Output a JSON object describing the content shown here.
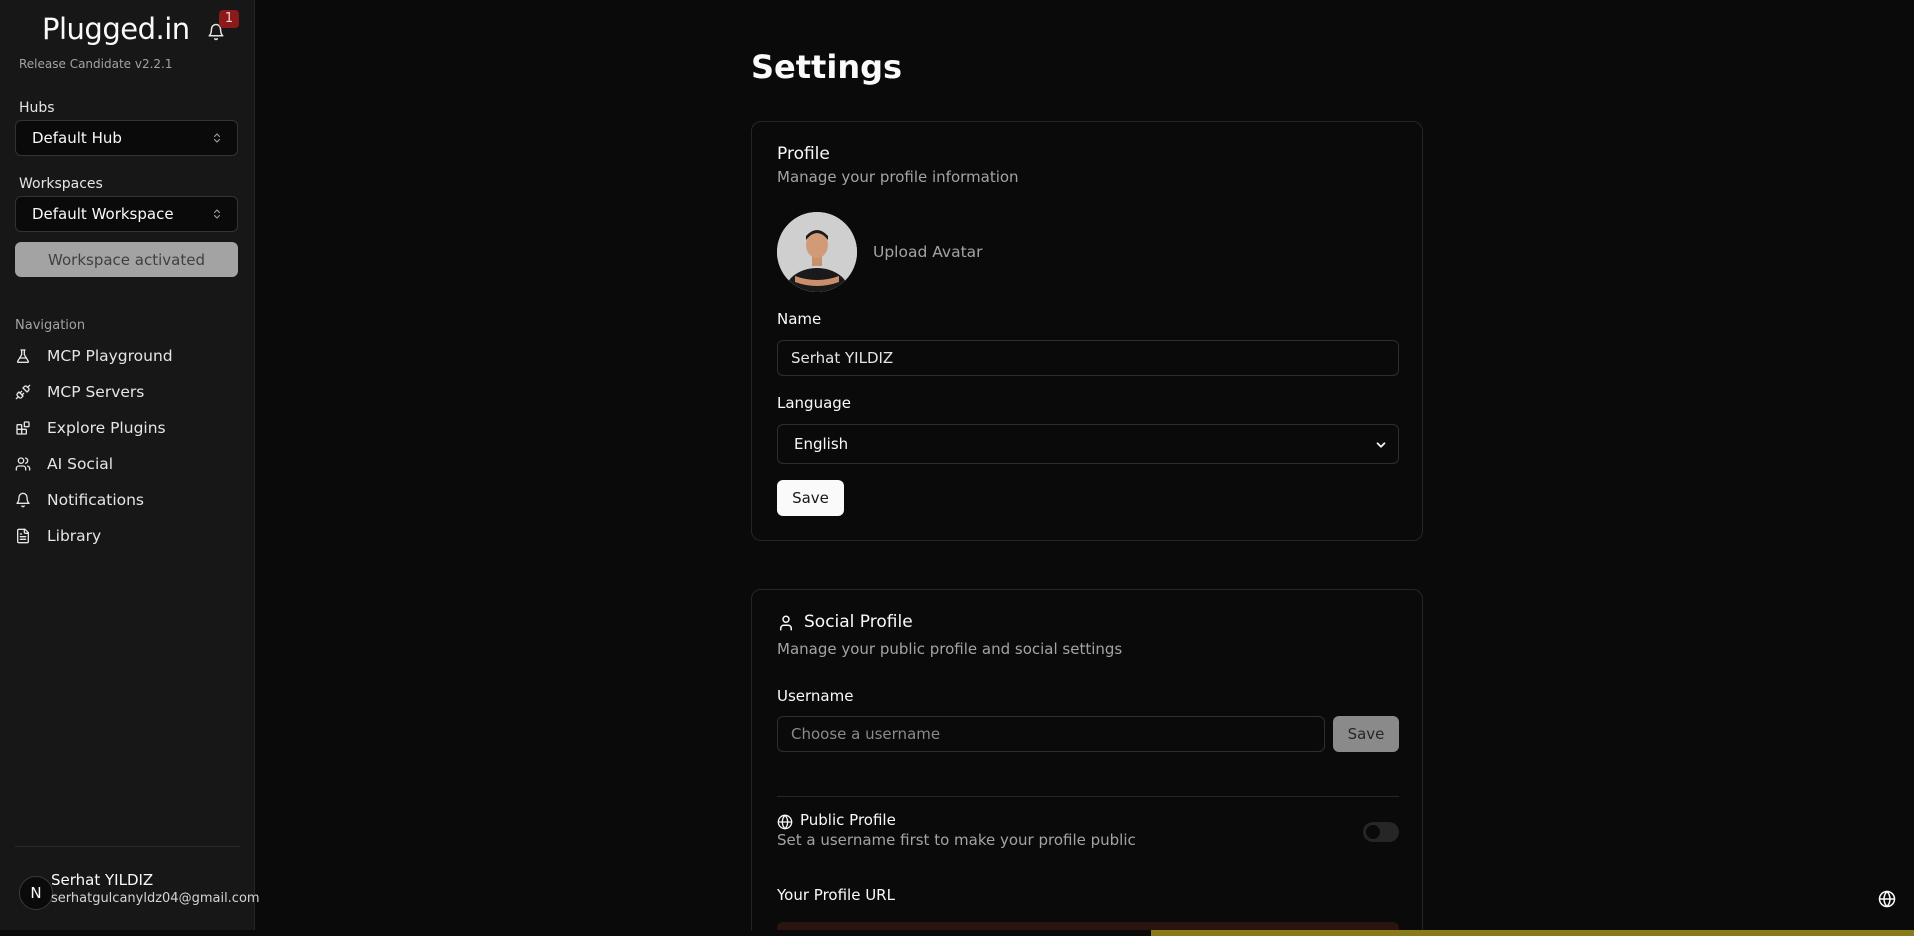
{
  "sidebar": {
    "logo": "Plugged.in",
    "notification_count": "1",
    "version": "Release Candidate v2.2.1",
    "hubs_label": "Hubs",
    "hub_selected": "Default Hub",
    "workspaces_label": "Workspaces",
    "workspace_selected": "Default Workspace",
    "workspace_button": "Workspace activated",
    "nav_title": "Navigation",
    "nav_items": [
      {
        "label": "MCP Playground",
        "icon": "flask-icon"
      },
      {
        "label": "MCP Servers",
        "icon": "plug-icon"
      },
      {
        "label": "Explore Plugins",
        "icon": "blocks-icon"
      },
      {
        "label": "AI Social",
        "icon": "users-icon"
      },
      {
        "label": "Notifications",
        "icon": "bell-icon"
      },
      {
        "label": "Library",
        "icon": "document-icon"
      }
    ],
    "user": {
      "initial": "N",
      "name": "Serhat YILDIZ",
      "email": "serhatgulcanyldz04@gmail.com"
    }
  },
  "main": {
    "title": "Settings",
    "profile_card": {
      "title": "Profile",
      "subtitle": "Manage your profile information",
      "upload_label": "Upload Avatar",
      "name_label": "Name",
      "name_value": "Serhat YILDIZ",
      "language_label": "Language",
      "language_value": "English",
      "save_label": "Save"
    },
    "social_card": {
      "title": "Social Profile",
      "subtitle": "Manage your public profile and social settings",
      "username_label": "Username",
      "username_placeholder": "Choose a username",
      "save_label": "Save",
      "public_title": "Public Profile",
      "public_sub": "Set a username first to make your profile public",
      "public_enabled": false,
      "url_label": "Your Profile URL"
    }
  },
  "colors": {
    "background": "#0a0a0a",
    "sidebar": "#171717",
    "badge": "#8b1a1a",
    "accent_bar": "#8a7a1a"
  }
}
